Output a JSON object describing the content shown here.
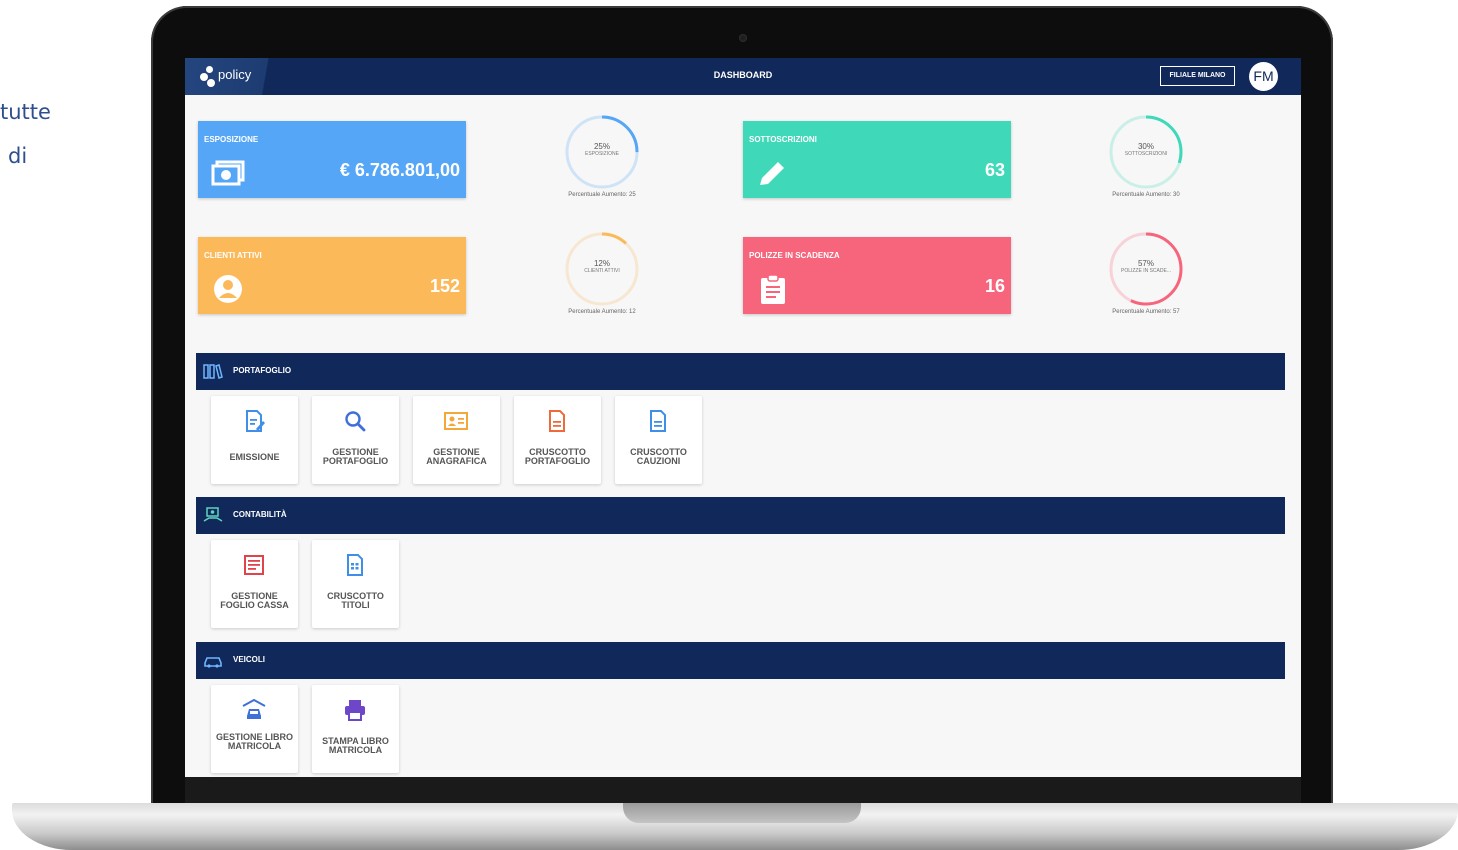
{
  "side_text": [
    "tutte",
    "di"
  ],
  "app": {
    "logo_text": "policy",
    "title": "DASHBOARD",
    "branch_button": "FILIALE MILANO",
    "avatar_initials": "FM",
    "brand_color": "#10285a"
  },
  "kpis": [
    {
      "label": "ESPOSIZIONE",
      "value": "€ 6.786.801,00",
      "color": "#56a6f7",
      "icon": "money-icon"
    },
    {
      "label": "SOTTOSCRIZIONI",
      "value": "63",
      "color": "#3fd9b9",
      "icon": "pencil-icon"
    },
    {
      "label": "CLIENTI ATTIVI",
      "value": "152",
      "color": "#fbb95a",
      "icon": "user-circle-icon"
    },
    {
      "label": "POLIZZE IN SCADENZA",
      "value": "16",
      "color": "#f6657c",
      "icon": "clipboard-icon"
    }
  ],
  "rings": [
    {
      "pct": "25%",
      "pct_value": 25,
      "sub": "ESPOSIZIONE",
      "caption": "Percentuale Aumento: 25",
      "color": "#56a6f7"
    },
    {
      "pct": "30%",
      "pct_value": 30,
      "sub": "SOTTOSCRIZIONI",
      "caption": "Percentuale Aumento: 30",
      "color": "#3fd9b9"
    },
    {
      "pct": "12%",
      "pct_value": 12,
      "sub": "CLIENTI ATTIVI",
      "caption": "Percentuale Aumento: 12",
      "color": "#fbb95a"
    },
    {
      "pct": "57%",
      "pct_value": 57,
      "sub": "POLIZZE IN SCADE...",
      "caption": "Percentuale Aumento: 57",
      "color": "#f6657c"
    }
  ],
  "sections": [
    {
      "title": "PORTAFOGLIO",
      "icon": "books-icon",
      "tiles": [
        {
          "label": "EMISSIONE",
          "icon": "edit-document-icon",
          "color": "#3f8fe8"
        },
        {
          "label": "GESTIONE PORTAFOGLIO",
          "icon": "search-icon",
          "color": "#3f6fd8"
        },
        {
          "label": "GESTIONE ANAGRAFICA",
          "icon": "id-card-icon",
          "color": "#f3a83b"
        },
        {
          "label": "CRUSCOTTO PORTAFOGLIO",
          "icon": "document-icon",
          "color": "#ef6a3a"
        },
        {
          "label": "CRUSCOTTO CAUZIONI",
          "icon": "document-icon",
          "color": "#3f8fe8"
        }
      ]
    },
    {
      "title": "CONTABILITÀ",
      "icon": "accounting-icon",
      "tiles": [
        {
          "label": "GESTIONE FOGLIO CASSA",
          "icon": "list-document-icon",
          "color": "#e0434a"
        },
        {
          "label": "CRUSCOTTO TITOLI",
          "icon": "spreadsheet-icon",
          "color": "#3f8fe8"
        }
      ]
    },
    {
      "title": "VEICOLI",
      "icon": "car-icon",
      "tiles": [
        {
          "label": "GESTIONE LIBRO MATRICOLA",
          "icon": "car-garage-icon",
          "color": "#3f6fd8"
        },
        {
          "label": "STAMPA LIBRO MATRICOLA",
          "icon": "printer-icon",
          "color": "#6e47c8"
        }
      ]
    }
  ]
}
